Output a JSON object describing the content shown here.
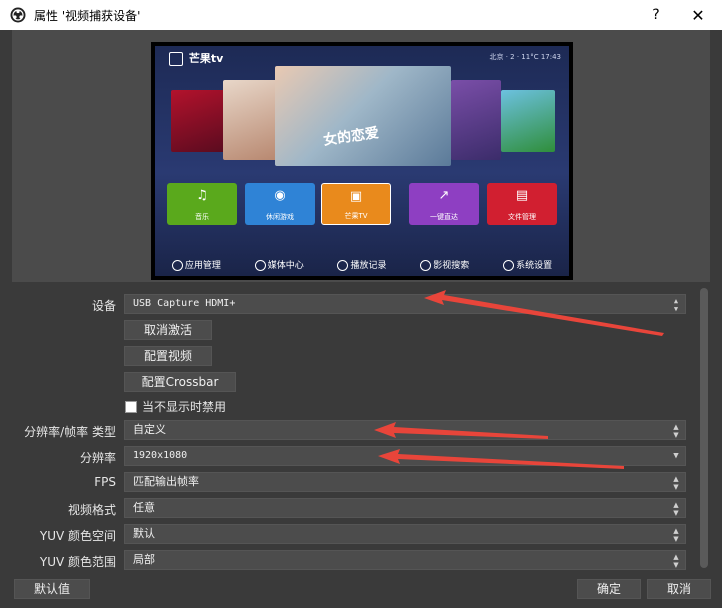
{
  "window": {
    "title": "属性 '视频捕获设备'",
    "help_glyph": "?",
    "close_glyph": "✕"
  },
  "preview": {
    "screen": {
      "logo_text": "芒果tv",
      "status_text": "北京 · 2 · 11°C  17:43",
      "poster_title": "女的恋爱",
      "tiles": [
        {
          "label": "音乐",
          "color": "#5aa91c",
          "icon": "♫"
        },
        {
          "label": "休闲游戏",
          "color": "#2f83d6",
          "icon": "◉"
        },
        {
          "label": "芒果TV",
          "color": "#e98a1c",
          "icon": "▣"
        },
        {
          "label": "一键直达",
          "color": "#8e3fc2",
          "icon": "↗"
        },
        {
          "label": "文件管理",
          "color": "#d11f30",
          "icon": "▤"
        }
      ],
      "nav": [
        "应用管理",
        "媒体中心",
        "播放记录",
        "影视搜索",
        "系统设置"
      ]
    }
  },
  "form": {
    "device": {
      "label": "设备",
      "value": "USB Capture HDMI+"
    },
    "buttons": {
      "deactivate": "取消激活",
      "config_video": "配置视频",
      "config_crossbar": "配置Crossbar"
    },
    "disable_when_hidden": {
      "label": "当不显示时禁用",
      "checked": false
    },
    "res_fps_type": {
      "label": "分辨率/帧率 类型",
      "value": "自定义"
    },
    "resolution": {
      "label": "分辨率",
      "value": "1920x1080"
    },
    "fps": {
      "label": "FPS",
      "value": "匹配输出帧率"
    },
    "video_format": {
      "label": "视频格式",
      "value": "任意"
    },
    "yuv_color_space": {
      "label": "YUV 颜色空间",
      "value": "默认"
    },
    "yuv_color_range": {
      "label": "YUV 颜色范围",
      "value": "局部"
    }
  },
  "footer": {
    "defaults": "默认值",
    "ok": "确定",
    "cancel": "取消"
  },
  "colors": {
    "annotation_arrow": "#e8453a"
  }
}
